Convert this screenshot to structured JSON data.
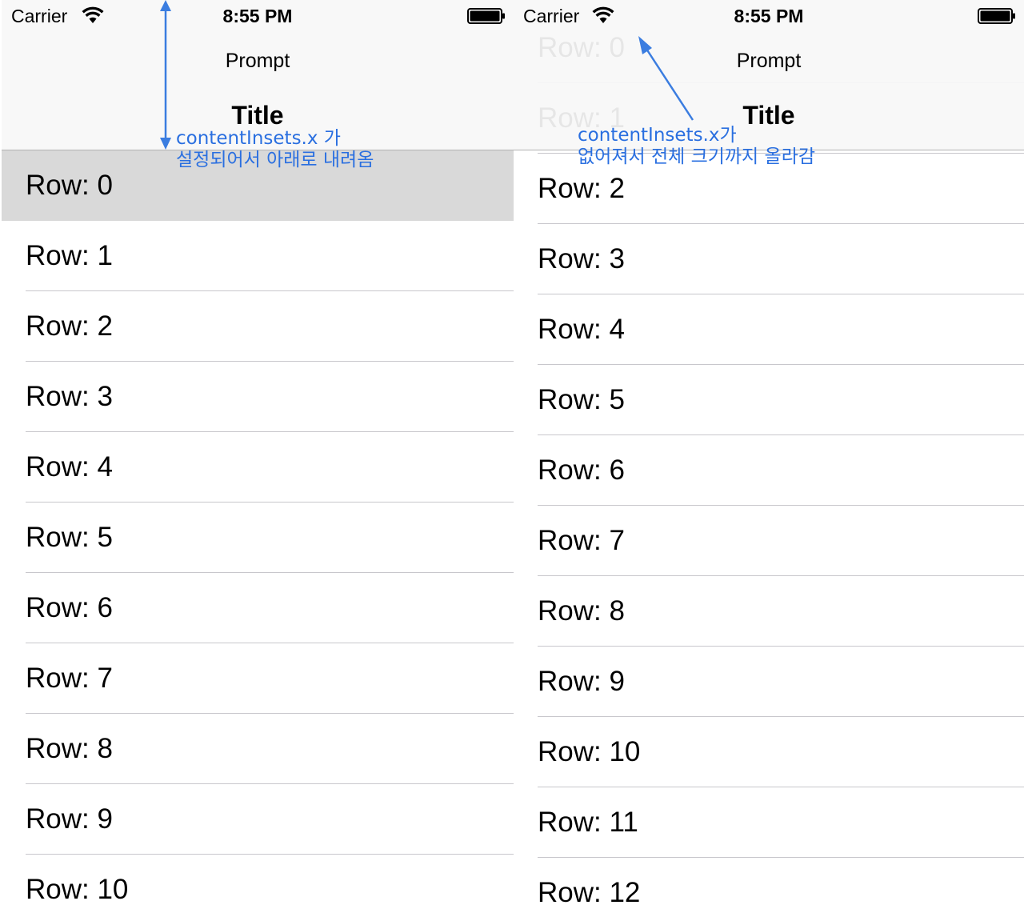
{
  "screens": [
    {
      "status_bar": {
        "carrier": "Carrier",
        "time": "8:55 PM"
      },
      "nav": {
        "prompt": "Prompt",
        "title": "Title"
      },
      "rows": [
        {
          "label": "Row: 0",
          "highlighted": true
        },
        {
          "label": "Row: 1"
        },
        {
          "label": "Row: 2"
        },
        {
          "label": "Row: 3"
        },
        {
          "label": "Row: 4"
        },
        {
          "label": "Row: 5"
        },
        {
          "label": "Row: 6"
        },
        {
          "label": "Row: 7"
        },
        {
          "label": "Row: 8"
        },
        {
          "label": "Row: 9"
        },
        {
          "label": "Row: 10"
        }
      ],
      "annotation": {
        "line1": "contentInsets.x 가",
        "line2": "설정되어서 아래로 내려옴"
      }
    },
    {
      "status_bar": {
        "carrier": "Carrier",
        "time": "8:55 PM"
      },
      "nav": {
        "prompt": "Prompt",
        "title": "Title"
      },
      "rows": [
        {
          "label": "Row: 0"
        },
        {
          "label": "Row: 1"
        },
        {
          "label": "Row: 2"
        },
        {
          "label": "Row: 3"
        },
        {
          "label": "Row: 4"
        },
        {
          "label": "Row: 5"
        },
        {
          "label": "Row: 6"
        },
        {
          "label": "Row: 7"
        },
        {
          "label": "Row: 8"
        },
        {
          "label": "Row: 9"
        },
        {
          "label": "Row: 10"
        },
        {
          "label": "Row: 11"
        },
        {
          "label": "Row: 12"
        }
      ],
      "annotation": {
        "line1": "contentInsets.x가",
        "line2": "없어져서 전체 크기까지 올라감"
      }
    }
  ],
  "colors": {
    "annotation": "#2a6fe0",
    "highlight": "#d9d9d9",
    "separator": "#c8c7cc",
    "navbar": "#f7f7f7"
  },
  "icons": {
    "wifi": "wifi-icon",
    "battery": "battery-icon"
  }
}
